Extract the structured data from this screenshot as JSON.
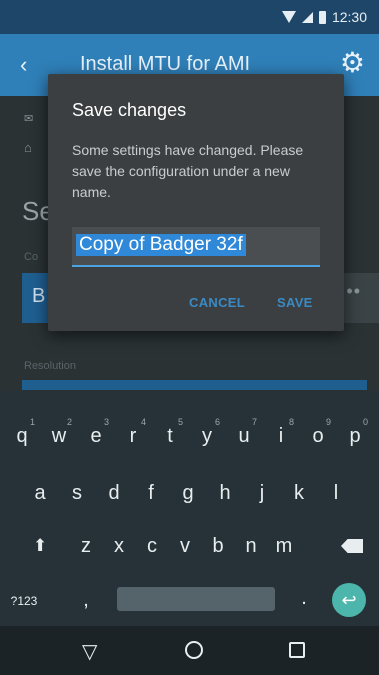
{
  "status_bar": {
    "time": "12:30"
  },
  "app_bar": {
    "title": "Install MTU for AMI",
    "back_icon": "back-chevron-icon",
    "settings_icon": "gear-icon"
  },
  "background": {
    "config_value_initial": "B",
    "config_more": "••",
    "heading_partial": "Se",
    "resolution_label": "Resolution",
    "config_label": "Co"
  },
  "dialog": {
    "title": "Save changes",
    "message": "Some settings have changed. Please save the configuration under a new name.",
    "input_value": "Copy of Badger 32f",
    "cancel_label": "CANCEL",
    "save_label": "SAVE",
    "accent_color": "#2f88d8"
  },
  "keyboard": {
    "row1": [
      {
        "key": "q",
        "hint": "1"
      },
      {
        "key": "w",
        "hint": "2"
      },
      {
        "key": "e",
        "hint": "3"
      },
      {
        "key": "r",
        "hint": "4"
      },
      {
        "key": "t",
        "hint": "5"
      },
      {
        "key": "y",
        "hint": "6"
      },
      {
        "key": "u",
        "hint": "7"
      },
      {
        "key": "i",
        "hint": "8"
      },
      {
        "key": "o",
        "hint": "9"
      },
      {
        "key": "p",
        "hint": "0"
      }
    ],
    "row2": [
      "a",
      "s",
      "d",
      "f",
      "g",
      "h",
      "j",
      "k",
      "l"
    ],
    "row3": [
      "z",
      "x",
      "c",
      "v",
      "b",
      "n",
      "m"
    ],
    "symbols_label": "?123",
    "comma": ",",
    "period": ".",
    "enter_color": "#4db6ac"
  }
}
